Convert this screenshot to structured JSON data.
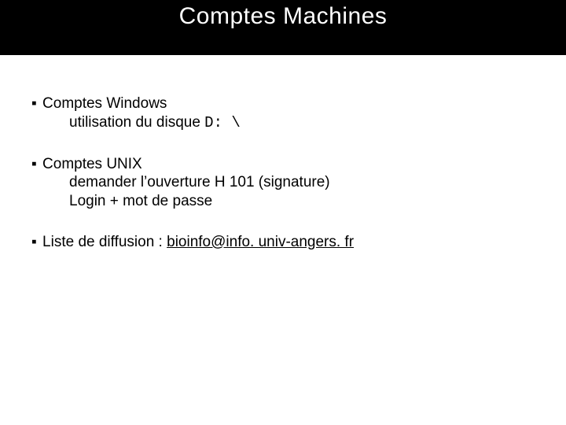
{
  "title": "Comptes Machines",
  "bullets": [
    {
      "head": "Comptes Windows",
      "subs": [
        {
          "text": "utilisation du disque ",
          "mono": "D: \\"
        }
      ]
    },
    {
      "head": "Comptes UNIX",
      "subs": [
        {
          "text": "demander l’ouverture H 101 (signature)"
        },
        {
          "text": "Login + mot de passe"
        }
      ]
    },
    {
      "head": "Liste de diffusion : ",
      "link": "bioinfo@info. univ-angers. fr"
    }
  ],
  "glyphs": {
    "square": "▪"
  }
}
